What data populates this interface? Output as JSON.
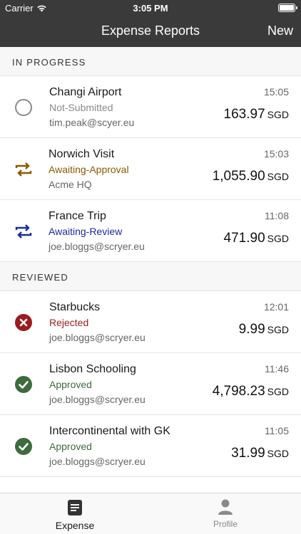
{
  "status_bar": {
    "carrier": "Carrier",
    "time": "3:05 PM"
  },
  "nav": {
    "title": "Expense Reports",
    "action": "New"
  },
  "colors": {
    "bar": "#3a3a3a",
    "not_submitted": "#8a8a8a",
    "awaiting_approval": "#8b5a00",
    "awaiting_review": "#1c2a9c",
    "rejected": "#9b1b1e",
    "approved": "#3e6b3e"
  },
  "sections": [
    {
      "header": "IN PROGRESS",
      "items": [
        {
          "name": "Changi Airport",
          "status": "Not-Submitted",
          "status_kind": "not_submitted",
          "subtitle": "tim.peak@scyer.eu",
          "time": "15:05",
          "amount": "163.97",
          "currency": "SGD",
          "icon": "circle-outline-icon"
        },
        {
          "name": "Norwich Visit",
          "status": "Awaiting-Approval",
          "status_kind": "awaiting_approval",
          "subtitle": "Acme HQ",
          "time": "15:03",
          "amount": "1,055.90",
          "currency": "SGD",
          "icon": "repeat-icon"
        },
        {
          "name": "France Trip",
          "status": "Awaiting-Review",
          "status_kind": "awaiting_review",
          "subtitle": "joe.bloggs@scryer.eu",
          "time": "11:08",
          "amount": "471.90",
          "currency": "SGD",
          "icon": "repeat-icon"
        }
      ]
    },
    {
      "header": "REVIEWED",
      "items": [
        {
          "name": "Starbucks",
          "status": "Rejected",
          "status_kind": "rejected",
          "subtitle": "joe.bloggs@scryer.eu",
          "time": "12:01",
          "amount": "9.99",
          "currency": "SGD",
          "icon": "x-circle-icon"
        },
        {
          "name": "Lisbon Schooling",
          "status": "Approved",
          "status_kind": "approved",
          "subtitle": "joe.bloggs@scryer.eu",
          "time": "11:46",
          "amount": "4,798.23",
          "currency": "SGD",
          "icon": "check-circle-icon"
        },
        {
          "name": "Intercontinental with GK",
          "status": "Approved",
          "status_kind": "approved",
          "subtitle": "joe.bloggs@scryer.eu",
          "time": "11:05",
          "amount": "31.99",
          "currency": "SGD",
          "icon": "check-circle-icon"
        }
      ]
    }
  ],
  "tabs": [
    {
      "label": "Expense",
      "icon": "document-icon",
      "active": true
    },
    {
      "label": "Profile",
      "icon": "person-icon",
      "active": false
    }
  ]
}
